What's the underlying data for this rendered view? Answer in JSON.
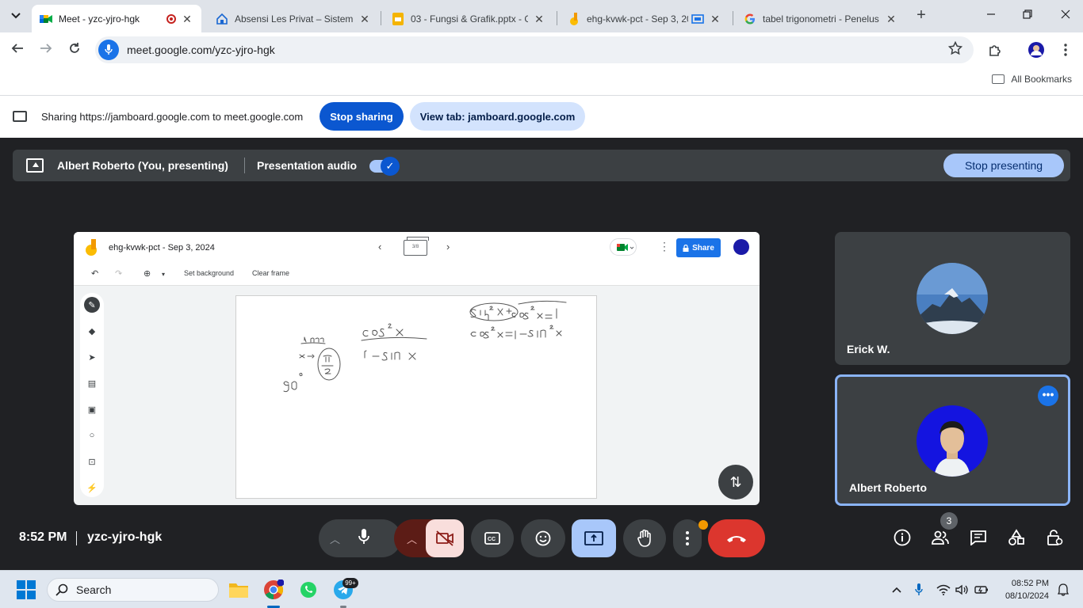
{
  "browser": {
    "tabs": [
      {
        "title": "Meet - yzc-yjro-hgk",
        "active": true,
        "recording": true
      },
      {
        "title": "Absensi Les Privat – Sistem P",
        "active": false
      },
      {
        "title": "03 - Fungsi & Grafik.pptx - G",
        "active": false
      },
      {
        "title": "ehg-kvwk-pct - Sep 3, 20",
        "active": false
      },
      {
        "title": "tabel trigonometri - Penelus",
        "active": false
      }
    ],
    "close_glyph": "✕",
    "new_tab_glyph": "+",
    "url": "meet.google.com/yzc-yjro-hgk",
    "bookmarks_label": "All Bookmarks"
  },
  "sharing_bar": {
    "text": "Sharing https://jamboard.google.com to meet.google.com",
    "stop_sharing": "Stop sharing",
    "view_tab": "View tab: jamboard.google.com"
  },
  "meet": {
    "presenter_label": "Albert Roberto (You, presenting)",
    "presentation_audio": "Presentation audio",
    "presentation_audio_on": true,
    "stop_presenting": "Stop presenting",
    "time": "8:52 PM",
    "meeting_code": "yzc-yjro-hgk",
    "participant_count": "3",
    "participants": [
      {
        "name": "Erick W."
      },
      {
        "name": "Albert Roberto"
      }
    ]
  },
  "jamboard": {
    "title": "ehg-kvwk-pct - Sep 3, 2024",
    "frame_indicator": "3/8",
    "share_label": "Share",
    "set_background": "Set background",
    "clear_frame": "Clear frame"
  },
  "taskbar": {
    "search_label": "Search",
    "telegram_badge": "99+",
    "time": "08:52 PM",
    "date": "08/10/2024"
  },
  "colors": {
    "meet_bg": "#202124",
    "accent_blue": "#0b57d0",
    "end_call_red": "#dc362e"
  }
}
